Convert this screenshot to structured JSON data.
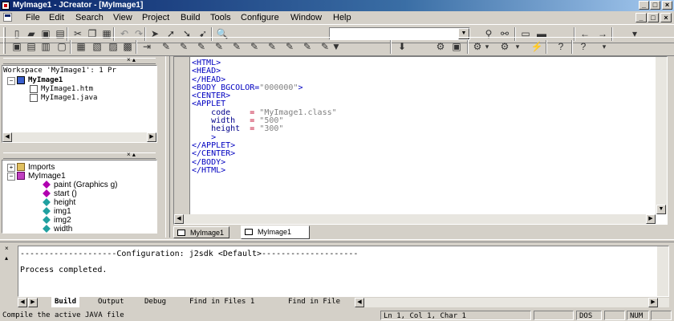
{
  "window": {
    "title": "MyImage1 - JCreator - [MyImage1]",
    "controls": [
      "_",
      "□",
      "×"
    ],
    "mdi_controls": [
      "_",
      "□",
      "×"
    ]
  },
  "menu": [
    "File",
    "Edit",
    "Search",
    "View",
    "Project",
    "Build",
    "Tools",
    "Configure",
    "Window",
    "Help"
  ],
  "toolbar1": {
    "buttons": [
      {
        "name": "new-file-icon",
        "glyph": "▯"
      },
      {
        "name": "open-folder-icon",
        "glyph": "▰"
      },
      {
        "name": "save-icon",
        "glyph": "▣"
      },
      {
        "name": "save-all-icon",
        "glyph": "▤"
      },
      {
        "name": "cut-icon",
        "glyph": "✂"
      },
      {
        "name": "copy-icon",
        "glyph": "❐"
      },
      {
        "name": "paste-icon",
        "glyph": "▦"
      },
      {
        "name": "undo-icon",
        "glyph": "↶"
      },
      {
        "name": "redo-icon",
        "glyph": "↷"
      },
      {
        "name": "bookmark-toggle-icon",
        "glyph": "➤"
      },
      {
        "name": "bookmark-next-icon",
        "glyph": "➚"
      },
      {
        "name": "bookmark-prev-icon",
        "glyph": "➘"
      },
      {
        "name": "bookmark-clear-icon",
        "glyph": "➹"
      },
      {
        "name": "find-binoculars-icon",
        "glyph": "🔍"
      }
    ],
    "search_value": "",
    "right_buttons": [
      {
        "name": "find-in-files-icon",
        "glyph": "⚲"
      },
      {
        "name": "replace-icon",
        "glyph": "⚯"
      },
      {
        "name": "window-icon",
        "glyph": "▭"
      },
      {
        "name": "cascade-icon",
        "glyph": "▬"
      },
      {
        "name": "back-arrow-icon",
        "glyph": "←"
      },
      {
        "name": "forward-arrow-icon",
        "glyph": "→"
      },
      {
        "name": "toolbar-dropdown-icon",
        "glyph": "▾"
      }
    ]
  },
  "toolbar2": {
    "buttons": [
      {
        "name": "workspace-view-icon",
        "glyph": "▣"
      },
      {
        "name": "file-view-icon",
        "glyph": "▤"
      },
      {
        "name": "output-view-icon",
        "glyph": "▥"
      },
      {
        "name": "fullscreen-view-icon",
        "glyph": "▢"
      },
      {
        "name": "tile-horizontal-icon",
        "glyph": "▦"
      },
      {
        "name": "tile-vertical-icon",
        "glyph": "▧"
      },
      {
        "name": "split-view-icon",
        "glyph": "▨"
      },
      {
        "name": "class-browser-icon",
        "glyph": "▩"
      },
      {
        "name": "indent-icon",
        "glyph": "⇥"
      },
      {
        "name": "comment-1-icon",
        "glyph": "✎"
      },
      {
        "name": "comment-2-icon",
        "glyph": "✎"
      },
      {
        "name": "comment-3-icon",
        "glyph": "✎"
      },
      {
        "name": "comment-4-icon",
        "glyph": "✎"
      },
      {
        "name": "comment-5-icon",
        "glyph": "✎"
      },
      {
        "name": "comment-6-icon",
        "glyph": "✎"
      },
      {
        "name": "comment-7-icon",
        "glyph": "✎"
      },
      {
        "name": "comment-8-icon",
        "glyph": "✎"
      },
      {
        "name": "comment-9-icon",
        "glyph": "✎"
      },
      {
        "name": "comment-10-icon",
        "glyph": "✎"
      },
      {
        "name": "build-file-icon",
        "glyph": "▼"
      },
      {
        "name": "compile-project-icon",
        "glyph": "⬇"
      },
      {
        "name": "execute-project-icon",
        "glyph": "⚙"
      },
      {
        "name": "debug-project-icon",
        "glyph": "▣"
      },
      {
        "name": "run-applet-icon",
        "glyph": "⚙"
      },
      {
        "name": "run-dropdown-icon",
        "glyph": "▾"
      },
      {
        "name": "configure-icon",
        "glyph": "⚙"
      },
      {
        "name": "configure-dropdown-icon",
        "glyph": "▾"
      },
      {
        "name": "tools-icon",
        "glyph": "⚡"
      },
      {
        "name": "help-icon",
        "glyph": "?"
      },
      {
        "name": "context-help-icon",
        "glyph": "?"
      },
      {
        "name": "toolbar2-dropdown-icon",
        "glyph": "▾"
      }
    ]
  },
  "workspace": {
    "header": "Workspace 'MyImage1': 1 Pr",
    "project": "MyImage1",
    "files": [
      "MyImage1.htm",
      "MyImage1.java"
    ]
  },
  "classview": {
    "imports": "Imports",
    "class_name": "MyImage1",
    "members": [
      "paint (Graphics g)",
      "start ()",
      "height",
      "img1",
      "img2",
      "width"
    ]
  },
  "editor": {
    "lines": [
      "<HTML>",
      "<HEAD>",
      "</HEAD>",
      "<BODY BGCOLOR=\"000000\">",
      "<CENTER>",
      "<APPLET",
      "    code    = \"MyImage1.class\"",
      "    width   = \"500\"",
      "    height  = \"300\"",
      "    >",
      "</APPLET>",
      "</CENTER>",
      "</BODY>",
      "</HTML>"
    ],
    "tabs": [
      "MyImage1",
      "MyImage1"
    ]
  },
  "output": {
    "lines": [
      "--------------------Configuration: j2sdk <Default>--------------------",
      "Process completed."
    ],
    "tabs": [
      "Build",
      "Output",
      "Debug",
      "Find in Files 1",
      "Find in File"
    ]
  },
  "status": {
    "message": "Compile the active JAVA file",
    "position": "Ln 1, Col 1, Char 1",
    "mode": "DOS",
    "num": "NUM"
  }
}
